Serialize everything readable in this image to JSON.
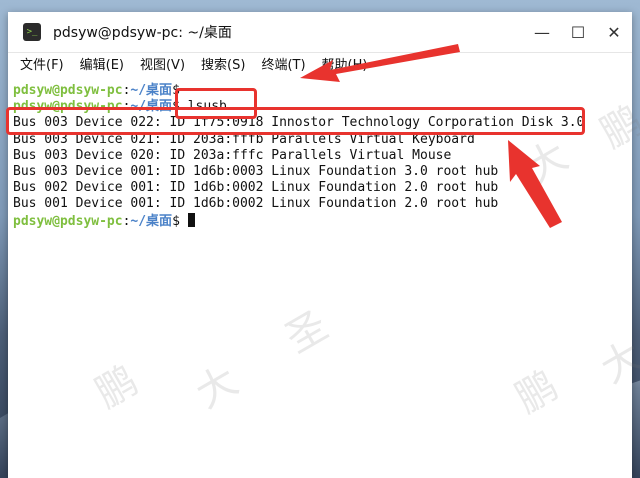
{
  "window": {
    "title": "pdsyw@pdsyw-pc: ~/桌面"
  },
  "window_controls": {
    "minimize": "—",
    "maximize": "☐",
    "close": "✕"
  },
  "menu": [
    "文件(F)",
    "编辑(E)",
    "视图(V)",
    "搜索(S)",
    "终端(T)",
    "帮助(H)"
  ],
  "prompt": {
    "user": "pdsyw@pdsyw-pc",
    "sep": ":",
    "path": "~/桌面",
    "symbol": "$"
  },
  "terminal": {
    "command": " lsusb",
    "output": [
      "Bus 003 Device 022: ID 1f75:0918 Innostor Technology Corporation Disk 3.0",
      "Bus 003 Device 021: ID 203a:fffb Parallels Virtual Keyboard",
      "Bus 003 Device 020: ID 203a:fffc Parallels Virtual Mouse",
      "Bus 003 Device 001: ID 1d6b:0003 Linux Foundation 3.0 root hub",
      "Bus 002 Device 001: ID 1d6b:0002 Linux Foundation 2.0 root hub",
      "Bus 001 Device 001: ID 1d6b:0002 Linux Foundation 2.0 root hub"
    ]
  },
  "watermark": {
    "char1": "鹏",
    "char2": "大",
    "char3": "圣"
  },
  "colors": {
    "annotation": "#e8332e",
    "prompt_user": "#7fbf3f",
    "prompt_path": "#4b82c8"
  }
}
